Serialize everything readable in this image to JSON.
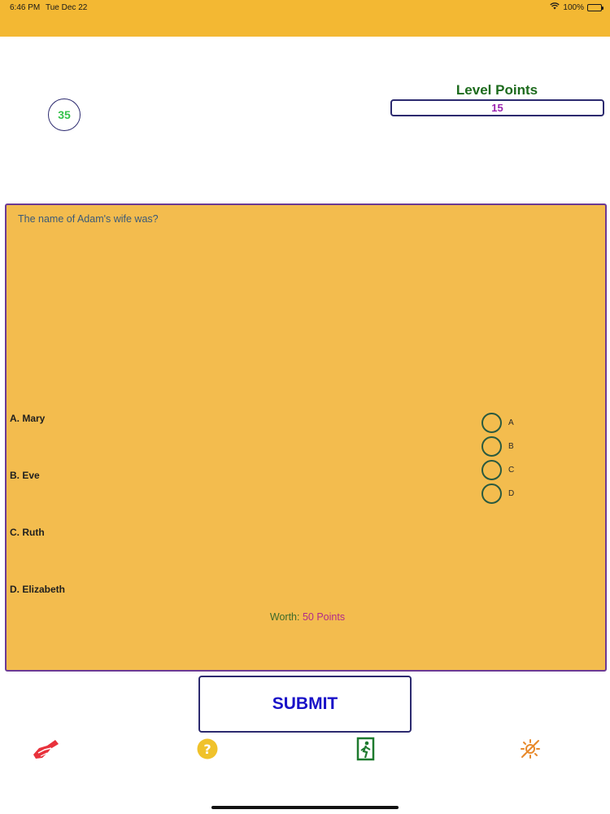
{
  "status_bar": {
    "time": "6:46 PM",
    "date": "Tue Dec 22",
    "battery": "100%"
  },
  "timer": {
    "value": "35"
  },
  "level_points": {
    "title": "Level Points",
    "value": "15"
  },
  "question": {
    "text": "The name of Adam's wife was?",
    "answers": [
      {
        "label": "A. Mary"
      },
      {
        "label": "B. Eve"
      },
      {
        "label": "C. Ruth"
      },
      {
        "label": "D. Elizabeth"
      }
    ],
    "options": [
      "A",
      "B",
      "C",
      "D"
    ],
    "worth_label": "Worth:",
    "worth_value": "50 Points"
  },
  "submit": {
    "label": "SUBMIT"
  },
  "toolbar": {
    "icons": [
      "swap-hands-icon",
      "help-icon",
      "exit-icon",
      "theme-icon"
    ]
  },
  "colors": {
    "accent": "#f3b833",
    "panel": "#f3bc4e",
    "panel_border": "#6c3a94",
    "submit_text": "#1a12c8"
  }
}
